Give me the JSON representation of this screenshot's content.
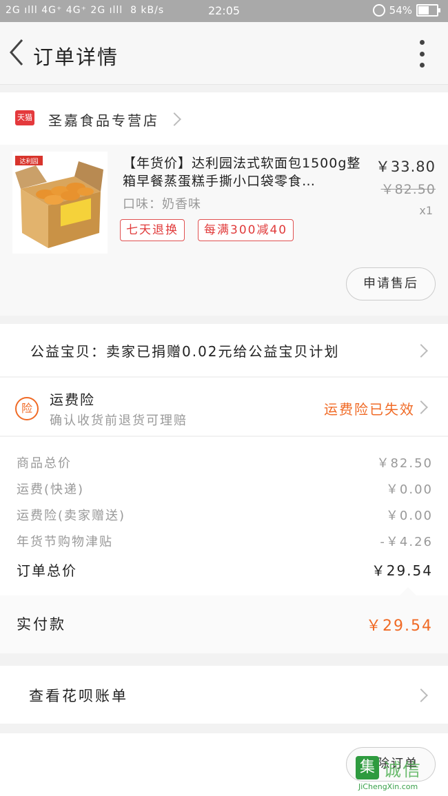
{
  "status_bar": {
    "signal_left": "2G ılll 4G⁺ 4G⁺ 2G ılll",
    "net_speed": "8 kB/s",
    "time": "22:05",
    "battery_text": "54%",
    "battery_level_percent": 54
  },
  "header": {
    "title": "订单详情"
  },
  "store": {
    "badge": "天猫",
    "name": "圣嘉食品专营店"
  },
  "product": {
    "title": "【年货价】达利园法式软面包1500g整箱早餐蒸蛋糕手撕小口袋零食…",
    "price": "￥33.80",
    "original_price": "￥82.50",
    "quantity": "x1",
    "flavor": "口味：奶香味",
    "tags": [
      "七天退换",
      "每满300减40"
    ],
    "after_sale_label": "申请售后",
    "image_brand": "达利园"
  },
  "charity": {
    "text": "公益宝贝：卖家已捐赠0.02元给公益宝贝计划"
  },
  "insurance": {
    "icon_char": "险",
    "name": "运费险",
    "desc": "确认收货前退货可理赔",
    "status": "运费险已失效"
  },
  "fees": [
    {
      "label": "商品总价",
      "value": "￥82.50"
    },
    {
      "label": "运费(快递)",
      "value": "￥0.00"
    },
    {
      "label": "运费险(卖家赠送)",
      "value": "￥0.00"
    },
    {
      "label": "年货节购物津贴",
      "value": "-￥4.26"
    },
    {
      "label": "订单总价",
      "value": "￥29.54"
    }
  ],
  "paid": {
    "label": "实付款",
    "value": "￥29.54"
  },
  "huabei": {
    "label": "查看花呗账单"
  },
  "actions": {
    "delete_label": "删除订单"
  },
  "watermark": {
    "logo_char": "集",
    "cn": "诚信",
    "en": "JiChengXin.com"
  },
  "colors": {
    "accent": "#f06a25",
    "tag_red": "#e03a3a",
    "tmall_red": "#e4393c",
    "status_bar_bg": "#a9a9a9"
  }
}
